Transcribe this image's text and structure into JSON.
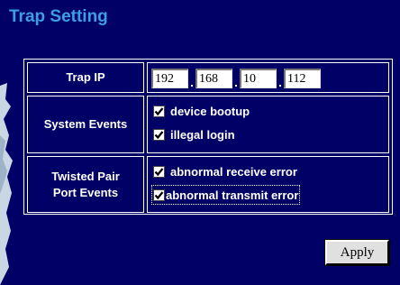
{
  "title": "Trap Setting",
  "trap_ip": {
    "label": "Trap IP",
    "octets": [
      "192",
      "168",
      "10",
      "112"
    ]
  },
  "system_events": {
    "label": "System Events",
    "options": [
      {
        "label": "device bootup",
        "checked": true
      },
      {
        "label": "illegal login",
        "checked": true
      }
    ]
  },
  "port_events": {
    "label_line1": "Twisted Pair",
    "label_line2": "Port Events",
    "options": [
      {
        "label": "abnormal receive error",
        "checked": true
      },
      {
        "label": "abnormal transmit error",
        "checked": true
      }
    ]
  },
  "apply_label": "Apply"
}
